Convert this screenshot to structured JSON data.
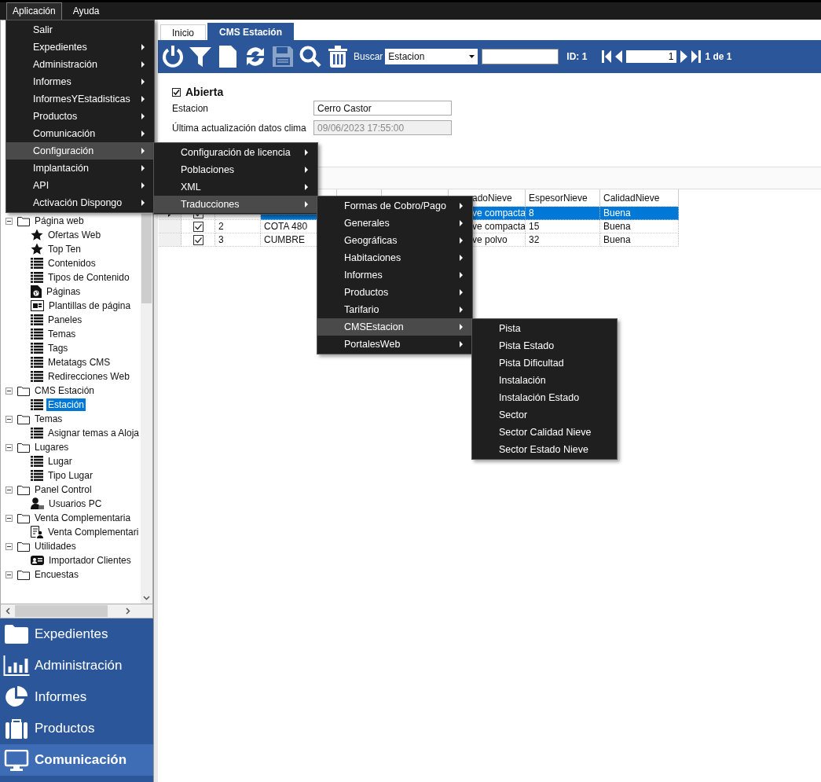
{
  "menubar": [
    {
      "label": "Aplicación",
      "selected": true
    },
    {
      "label": "Ayuda",
      "selected": false
    }
  ],
  "menus": [
    {
      "items": [
        {
          "label": "Salir",
          "submenu": false,
          "selected": false
        },
        {
          "label": "Expedientes",
          "submenu": true,
          "selected": false
        },
        {
          "label": "Administración",
          "submenu": true,
          "selected": false
        },
        {
          "label": "Informes",
          "submenu": true,
          "selected": false
        },
        {
          "label": "InformesYEstadisticas",
          "submenu": true,
          "selected": false
        },
        {
          "label": "Productos",
          "submenu": true,
          "selected": false
        },
        {
          "label": "Comunicación",
          "submenu": true,
          "selected": false
        },
        {
          "label": "Configuración",
          "submenu": true,
          "selected": true
        },
        {
          "label": "Implantación",
          "submenu": true,
          "selected": false
        },
        {
          "label": "API",
          "submenu": true,
          "selected": false
        },
        {
          "label": "Activación Dispongo",
          "submenu": true,
          "selected": false
        }
      ]
    },
    {
      "items": [
        {
          "label": "Configuración de licencia",
          "submenu": true,
          "selected": false
        },
        {
          "label": "Poblaciones",
          "submenu": true,
          "selected": false
        },
        {
          "label": "XML",
          "submenu": true,
          "selected": false
        },
        {
          "label": "Traducciones",
          "submenu": true,
          "selected": true
        }
      ]
    },
    {
      "items": [
        {
          "label": "Formas de Cobro/Pago",
          "submenu": true,
          "selected": false
        },
        {
          "label": "Generales",
          "submenu": true,
          "selected": false
        },
        {
          "label": "Geográficas",
          "submenu": true,
          "selected": false
        },
        {
          "label": "Habitaciones",
          "submenu": true,
          "selected": false
        },
        {
          "label": "Informes",
          "submenu": true,
          "selected": false
        },
        {
          "label": "Productos",
          "submenu": true,
          "selected": false
        },
        {
          "label": "Tarifario",
          "submenu": true,
          "selected": false
        },
        {
          "label": "CMSEstacion",
          "submenu": true,
          "selected": true
        },
        {
          "label": "PortalesWeb",
          "submenu": true,
          "selected": false
        }
      ]
    },
    {
      "items": [
        {
          "label": "Pista",
          "submenu": false,
          "selected": false
        },
        {
          "label": "Pista Estado",
          "submenu": false,
          "selected": false
        },
        {
          "label": "Pista Dificultad",
          "submenu": false,
          "selected": false
        },
        {
          "label": "Instalación",
          "submenu": false,
          "selected": false
        },
        {
          "label": "Instalación Estado",
          "submenu": false,
          "selected": false
        },
        {
          "label": "Sector",
          "submenu": false,
          "selected": false
        },
        {
          "label": "Sector Calidad Nieve",
          "submenu": false,
          "selected": false
        },
        {
          "label": "Sector Estado Nieve",
          "submenu": false,
          "selected": false
        }
      ]
    }
  ],
  "tree": [
    {
      "label": "Página web",
      "expanded": true,
      "selected": false,
      "children": [
        {
          "label": "Ofertas Web",
          "kind": "star",
          "selected": false
        },
        {
          "label": "Top Ten",
          "kind": "star",
          "selected": false
        },
        {
          "label": "Contenidos",
          "kind": "list",
          "selected": false
        },
        {
          "label": "Tipos de Contenido",
          "kind": "list",
          "selected": false
        },
        {
          "label": "Páginas",
          "kind": "page",
          "selected": false
        },
        {
          "label": "Plantillas de página",
          "kind": "template",
          "selected": false
        },
        {
          "label": "Paneles",
          "kind": "list",
          "selected": false
        },
        {
          "label": "Temas",
          "kind": "list",
          "selected": false
        },
        {
          "label": "Tags",
          "kind": "list",
          "selected": false
        },
        {
          "label": "Metatags CMS",
          "kind": "list",
          "selected": false
        },
        {
          "label": "Redirecciones Web",
          "kind": "list",
          "selected": false
        }
      ]
    },
    {
      "label": "CMS Estación",
      "expanded": true,
      "selected": false,
      "children": [
        {
          "label": "Estación",
          "kind": "list",
          "selected": true
        }
      ]
    },
    {
      "label": "Temas",
      "expanded": true,
      "selected": false,
      "children": [
        {
          "label": "Asignar temas a Aloja",
          "kind": "list",
          "selected": false
        }
      ]
    },
    {
      "label": "Lugares",
      "expanded": true,
      "selected": false,
      "children": [
        {
          "label": "Lugar",
          "kind": "list",
          "selected": false
        },
        {
          "label": "Tipo Lugar",
          "kind": "list",
          "selected": false
        }
      ]
    },
    {
      "label": "Panel Control",
      "expanded": true,
      "selected": false,
      "children": [
        {
          "label": "Usuarios PC",
          "kind": "user",
          "selected": false
        }
      ]
    },
    {
      "label": "Venta Complementaria",
      "expanded": true,
      "selected": false,
      "children": [
        {
          "label": "Venta Complementari",
          "kind": "document",
          "selected": false
        }
      ]
    },
    {
      "label": "Utilidades",
      "expanded": true,
      "selected": false,
      "children": [
        {
          "label": "Importador Clientes",
          "kind": "card",
          "selected": false
        }
      ]
    },
    {
      "label": "Encuestas",
      "expanded": true,
      "selected": false
    }
  ],
  "nav": [
    {
      "label": "Expedientes",
      "kind": "folder",
      "selected": false
    },
    {
      "label": "Administración",
      "kind": "chart",
      "selected": false
    },
    {
      "label": "Informes",
      "kind": "pie",
      "selected": false
    },
    {
      "label": "Productos",
      "kind": "briefcase",
      "selected": false
    },
    {
      "label": "Comunicación",
      "kind": "monitor",
      "selected": true
    }
  ],
  "tabs": [
    {
      "label": "Inicio",
      "selected": false
    },
    {
      "label": "CMS Estación",
      "selected": true
    }
  ],
  "toolbar": {
    "tools": [
      {
        "kind": "power",
        "disabled": false
      },
      {
        "kind": "filter",
        "disabled": false
      },
      {
        "kind": "new",
        "disabled": false
      },
      {
        "kind": "refresh",
        "disabled": false
      },
      {
        "kind": "save",
        "disabled": true
      },
      {
        "kind": "search",
        "disabled": false
      },
      {
        "kind": "delete",
        "disabled": false
      }
    ],
    "search_label": "Buscar",
    "search_field": "Estacion",
    "id_label": "ID: 1",
    "page": "1",
    "page_count": "1 de 1"
  },
  "form": {
    "abierta": {
      "label": "Abierta",
      "checked": true
    },
    "fields": [
      {
        "label": "Estacion",
        "value": "Cerro Castor",
        "disabled": false
      },
      {
        "label": "Última actualización datos clima",
        "value": "09/06/2023 17:55:00",
        "disabled": true
      }
    ]
  },
  "grid": {
    "columns": [
      {
        "header": "adoNieve",
        "kind": "partial"
      },
      {
        "header": "EspesorNieve",
        "kind": "plain"
      },
      {
        "header": "CalidadNieve",
        "kind": "plain"
      }
    ],
    "rows": [
      {
        "selected": true,
        "checked": true,
        "cells": [
          "ve compacta",
          "8",
          "Buena"
        ]
      },
      {
        "selected": false,
        "checked": true,
        "number": "2",
        "name": "COTA 480",
        "cells": [
          "ve compacta",
          "15",
          "Buena"
        ]
      },
      {
        "selected": false,
        "checked": true,
        "number": "3",
        "name": "CUMBRE",
        "cells": [
          "ve polvo",
          "32",
          "Buena"
        ]
      }
    ]
  }
}
